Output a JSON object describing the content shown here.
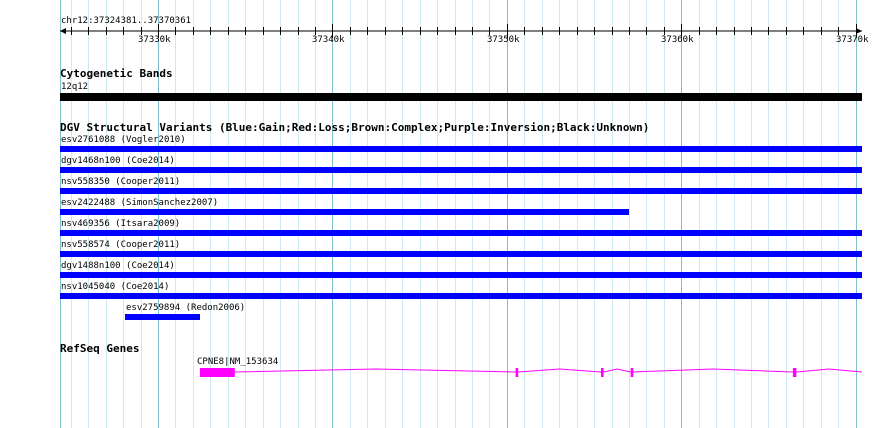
{
  "view": {
    "coordinates_label": "chr12:37324381..37370361",
    "start": 37324381,
    "end": 37370361
  },
  "ruler": {
    "major_ticks": [
      {
        "position": 37330000,
        "label": "37330k"
      },
      {
        "position": 37340000,
        "label": "37340k"
      },
      {
        "position": 37350000,
        "label": "37350k"
      },
      {
        "position": 37360000,
        "label": "37360k"
      },
      {
        "position": 37370000,
        "label": "37370k"
      }
    ],
    "minor_step": 1000
  },
  "tracks": {
    "cytoband": {
      "title": "Cytogenetic Bands",
      "band_label": "12q12",
      "color": "#000000"
    },
    "dgv": {
      "title": "DGV Structural Variants (Blue:Gain;Red:Loss;Brown:Complex;Purple:Inversion;Black:Unknown)",
      "color": "#0000ff",
      "variants": [
        {
          "label": "esv2761088 (Vogler2010)",
          "start": 37324381,
          "end": 37370361
        },
        {
          "label": "dgv1468n100 (Coe2014)",
          "start": 37324381,
          "end": 37370361
        },
        {
          "label": "nsv558350 (Cooper2011)",
          "start": 37324381,
          "end": 37370361
        },
        {
          "label": "esv2422488 (SimonSanchez2007)",
          "start": 37324381,
          "end": 37357000
        },
        {
          "label": "nsv469356 (Itsara2009)",
          "start": 37324381,
          "end": 37370361
        },
        {
          "label": "nsv558574 (Cooper2011)",
          "start": 37324381,
          "end": 37370361
        },
        {
          "label": "dgv1488n100 (Coe2014)",
          "start": 37324381,
          "end": 37370361
        },
        {
          "label": "nsv1045040 (Coe2014)",
          "start": 37324381,
          "end": 37370361
        },
        {
          "label": "esv2759894 (Redon2006)",
          "start": 37328100,
          "end": 37332400
        }
      ]
    },
    "refseq": {
      "title": "RefSeq Genes",
      "gene_label": "CPNE8|NM_153634",
      "color": "#ff00ff",
      "start": 37332400,
      "end": 37370361,
      "exons": [
        {
          "start": 37332400,
          "end": 37334400
        },
        {
          "start": 37350500,
          "end": 37350650
        },
        {
          "start": 37355400,
          "end": 37355550
        },
        {
          "start": 37357100,
          "end": 37357250
        },
        {
          "start": 37366400,
          "end": 37366600
        }
      ]
    }
  },
  "colors": {
    "grid_major": "#7fbfd0",
    "grid_minor": "#cfe9f0"
  }
}
